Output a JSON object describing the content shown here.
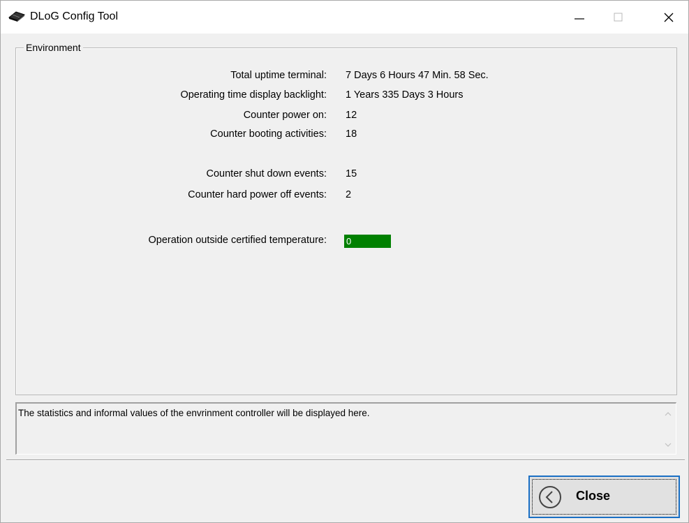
{
  "window": {
    "title": "DLoG Config Tool",
    "icon": "chip-icon"
  },
  "controls": {
    "minimize_glyph": "—",
    "maximize_glyph": "□",
    "close_glyph": "✕"
  },
  "environment": {
    "group_label": "Environment",
    "rows": [
      {
        "label": "Total uptime terminal:",
        "value": "7 Days 6 Hours 47 Min. 58 Sec."
      },
      {
        "label": "Operating time display backlight:",
        "value": "1 Years 335 Days 3 Hours"
      },
      {
        "label": "Counter power on:",
        "value": "12"
      },
      {
        "label": "Counter booting activities:",
        "value": "18"
      },
      {
        "label": "Counter shut down events:",
        "value": "15"
      },
      {
        "label": "Counter hard power off events:",
        "value": "2"
      }
    ],
    "temperature": {
      "label": "Operation outside certified temperature:",
      "value": "0",
      "color": "#008000"
    }
  },
  "info": {
    "text": "The statistics and informal values of the envrinment controller will be displayed here."
  },
  "footer": {
    "close_label": "Close",
    "close_icon": "back-arrow-circle-icon",
    "accent": "#1a6fc4"
  }
}
